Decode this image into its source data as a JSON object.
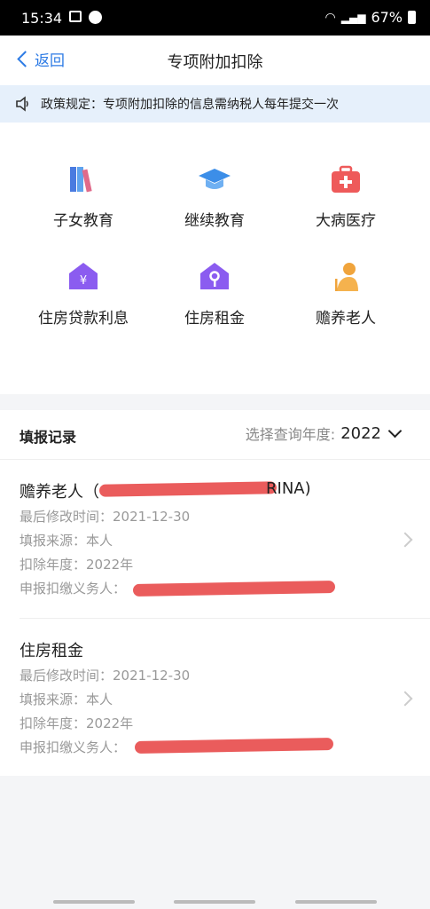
{
  "status_bar": {
    "time": "15:34",
    "battery": "67%"
  },
  "nav": {
    "back_label": "返回",
    "title": "专项附加扣除"
  },
  "policy_notice": "政策规定：专项附加扣除的信息需纳税人每年提交一次",
  "categories": [
    {
      "label": "子女教育",
      "icon": "books-icon"
    },
    {
      "label": "继续教育",
      "icon": "graduation-cap-icon"
    },
    {
      "label": "大病医疗",
      "icon": "medical-kit-icon"
    },
    {
      "label": "住房贷款利息",
      "icon": "house-yuan-icon"
    },
    {
      "label": "住房租金",
      "icon": "house-key-icon"
    },
    {
      "label": "赡养老人",
      "icon": "elderly-person-icon"
    }
  ],
  "records": {
    "title": "填报记录",
    "year_label": "选择查询年度:",
    "year": "2022",
    "items": [
      {
        "name": "赡养老人（",
        "name_suffix": "RINA)",
        "modified": "最后修改时间：2021-12-30",
        "source": "填报来源：本人",
        "deduct_year": "扣除年度：2022年",
        "withholder": "申报扣缴义务人："
      },
      {
        "name": "住房租金",
        "modified": "最后修改时间：2021-12-30",
        "source": "填报来源：本人",
        "deduct_year": "扣除年度：2022年",
        "withholder": "申报扣缴义务人："
      }
    ]
  },
  "colors": {
    "accent": "#2d7be5",
    "notice_bg": "#e6f0fb",
    "redaction": "#e84a4a"
  }
}
